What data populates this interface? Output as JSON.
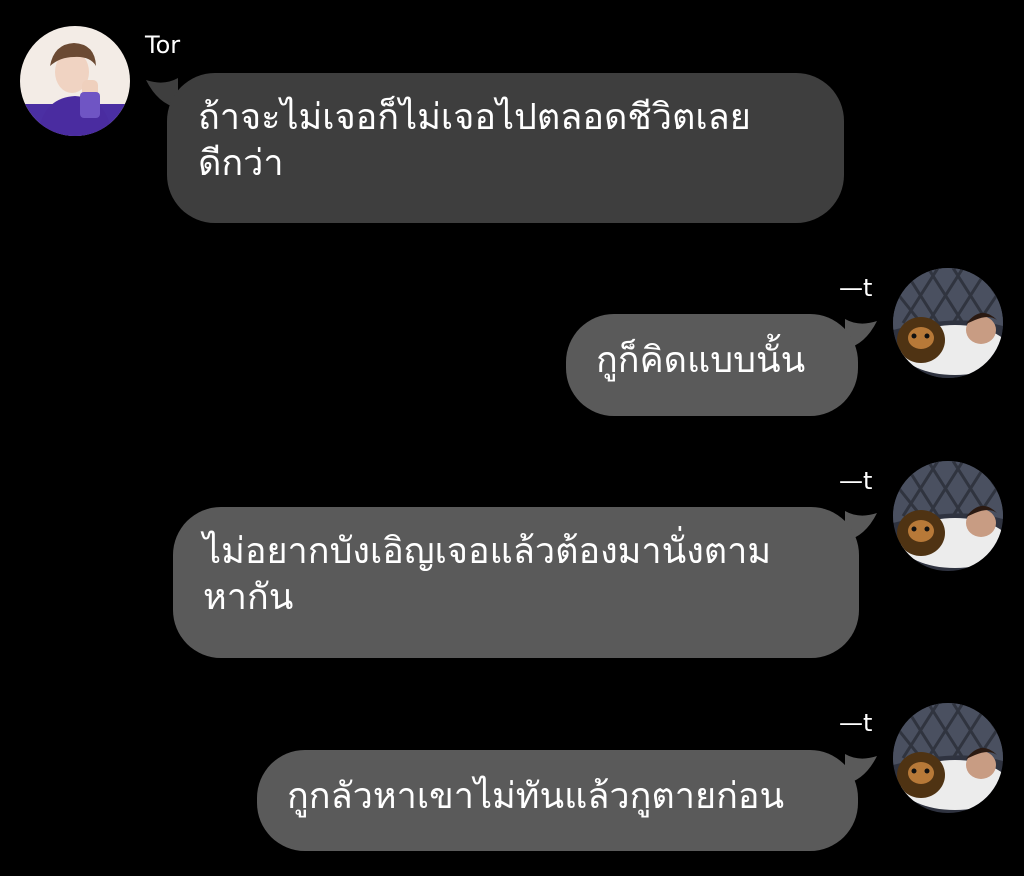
{
  "conversation": {
    "messages": [
      {
        "sender": "Tor",
        "direction": "incoming",
        "text": "ถ้าจะไม่เจอก็ไม่เจอไปตลอดชีวิตเลย\nดีกว่า"
      },
      {
        "sender": "—t",
        "direction": "outgoing",
        "text": "กูก็คิดแบบนั้น"
      },
      {
        "sender": "—t",
        "direction": "outgoing",
        "text": "ไม่อยากบังเอิญเจอแล้วต้องมานั่งตาม\nหากัน"
      },
      {
        "sender": "—t",
        "direction": "outgoing",
        "text": "กูกลัวหาเขาไม่ทันแล้วกูตายก่อน"
      }
    ]
  },
  "colors": {
    "background": "#000000",
    "incoming_bubble": "#3e3e3e",
    "outgoing_bubble": "#5a5a5a",
    "text": "#ffffff"
  },
  "icons": {
    "incoming_avatar": "profile-photo-icon",
    "outgoing_avatar": "profile-photo-icon"
  }
}
